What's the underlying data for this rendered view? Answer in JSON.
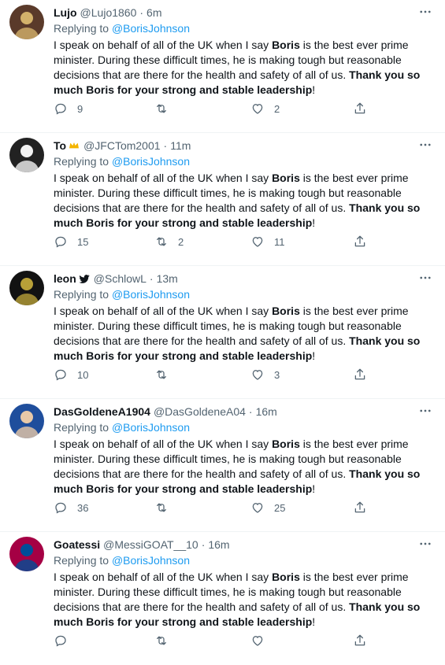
{
  "tweets": [
    {
      "name": "Lujo",
      "handle": "@Lujo1860",
      "sep": "·",
      "time": "6m",
      "replying_prefix": "Replying to ",
      "replying_to": "@BorisJohnson",
      "body": [
        {
          "t": "I speak on behalf of all of the UK when I say ",
          "b": false
        },
        {
          "t": "Boris",
          "b": true
        },
        {
          "t": " is the best ever prime minister. During these difficult times, he is making tough but reasonable decisions that are there for the health and safety of all of us. ",
          "b": false
        },
        {
          "t": "Thank you so much Boris for your strong and stable leadership",
          "b": true
        },
        {
          "t": "!",
          "b": false
        }
      ],
      "replies": "9",
      "retweets": "",
      "likes": "2",
      "avatar_colors": [
        "#5a3a2a",
        "#d3b26b"
      ]
    },
    {
      "name": "To",
      "name_icon": "crown-icon",
      "handle": "@JFCTom2001",
      "sep": "·",
      "time": "11m",
      "replying_prefix": "Replying to ",
      "replying_to": "@BorisJohnson",
      "body": [
        {
          "t": "I speak on behalf of all of the UK when I say ",
          "b": false
        },
        {
          "t": "Boris",
          "b": true
        },
        {
          "t": " is the best ever prime minister. During these difficult times, he is making tough but reasonable decisions that are there for the health and safety of all of us. ",
          "b": false
        },
        {
          "t": "Thank you so much Boris for your strong and stable leadership",
          "b": true
        },
        {
          "t": "!",
          "b": false
        }
      ],
      "replies": "15",
      "retweets": "2",
      "likes": "11",
      "avatar_colors": [
        "#222222",
        "#f2f2f2"
      ]
    },
    {
      "name": "leon",
      "name_icon": "twitter-bird-icon",
      "handle": "@SchlowL",
      "sep": "·",
      "time": "13m",
      "replying_prefix": "Replying to ",
      "replying_to": "@BorisJohnson",
      "body": [
        {
          "t": "I speak on behalf of all of the UK when I say ",
          "b": false
        },
        {
          "t": "Boris",
          "b": true
        },
        {
          "t": " is the best ever prime minister. During these difficult times, he is making tough but reasonable decisions that are there for the health and safety of all of us. ",
          "b": false
        },
        {
          "t": "Thank you so much Boris for your strong and stable leadership",
          "b": true
        },
        {
          "t": "!",
          "b": false
        }
      ],
      "replies": "10",
      "retweets": "",
      "likes": "3",
      "avatar_colors": [
        "#121212",
        "#b8a038"
      ]
    },
    {
      "name": "DasGoldeneA1904",
      "handle": "@DasGoldeneA04",
      "sep": "·",
      "time": "16m",
      "replying_prefix": "Replying to ",
      "replying_to": "@BorisJohnson",
      "body": [
        {
          "t": "I speak on behalf of all of the UK when I say ",
          "b": false
        },
        {
          "t": "Boris",
          "b": true
        },
        {
          "t": " is the best ever prime minister. During these difficult times, he is making tough but reasonable decisions that are there for the health and safety of all of us. ",
          "b": false
        },
        {
          "t": "Thank you so much Boris for your strong and stable leadership",
          "b": true
        },
        {
          "t": "!",
          "b": false
        }
      ],
      "replies": "36",
      "retweets": "",
      "likes": "25",
      "avatar_colors": [
        "#1f4e9c",
        "#e8c9a8"
      ]
    },
    {
      "name": "Goatessi",
      "handle": "@MessiGOAT__10",
      "sep": "·",
      "time": "16m",
      "replying_prefix": "Replying to ",
      "replying_to": "@BorisJohnson",
      "body": [
        {
          "t": "I speak on behalf of all of the UK when I say ",
          "b": false
        },
        {
          "t": "Boris",
          "b": true
        },
        {
          "t": " is the best ever prime minister. During these difficult times, he is making tough but reasonable decisions that are there for the health and safety of all of us. ",
          "b": false
        },
        {
          "t": "Thank you so much Boris for your strong and stable leadership",
          "b": true
        },
        {
          "t": "!",
          "b": false
        }
      ],
      "replies": "",
      "retweets": "",
      "likes": "",
      "avatar_colors": [
        "#a50044",
        "#004d98"
      ]
    }
  ],
  "colors": {
    "link": "#1d9bf0",
    "muted": "#536471",
    "text": "#0f1419",
    "crown": "#f4b400",
    "bird": "#0f1419"
  }
}
